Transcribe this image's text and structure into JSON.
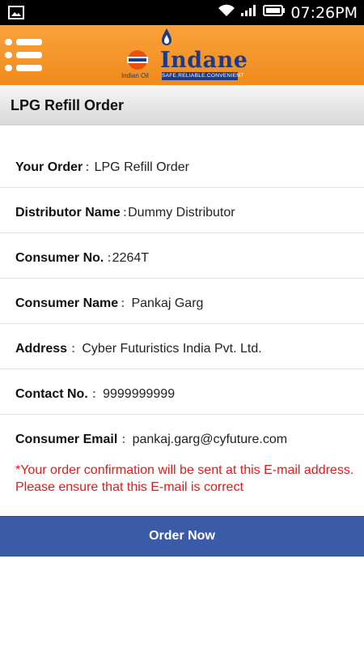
{
  "status_bar": {
    "time": "07:26PM"
  },
  "app_bar": {
    "brand": "Indane",
    "tagline": "SAFE.RELIABLE.CONVENIENT",
    "company": "Indian Oil"
  },
  "page": {
    "title": "LPG Refill Order"
  },
  "form": {
    "rows": [
      {
        "label": "Your Order",
        "separator": ":",
        "value": "LPG Refill Order"
      },
      {
        "label": "Distributor Name",
        "separator": ":",
        "value": "Dummy Distributor"
      },
      {
        "label": "Consumer No.",
        "separator": ":",
        "value": "2264T"
      },
      {
        "label": "Consumer Name",
        "separator": ":",
        "value": "Pankaj Garg"
      },
      {
        "label": "Address",
        "separator": ":",
        "value": "Cyber Futuristics India Pvt. Ltd."
      },
      {
        "label": "Contact No.",
        "separator": ":",
        "value": "9999999999"
      },
      {
        "label": "Consumer Email",
        "separator": ":",
        "value": "pankaj.garg@cyfuture.com"
      }
    ],
    "email_note": "*Your order confirmation will be sent at this E-mail address. Please ensure that this E-mail is correct"
  },
  "actions": {
    "order_now_label": "Order Now"
  },
  "colors": {
    "brand_orange": "#f08a1c",
    "brand_blue": "#1b3c8d",
    "button_blue": "#3a5ba7",
    "warning_red": "#e01b1b"
  }
}
